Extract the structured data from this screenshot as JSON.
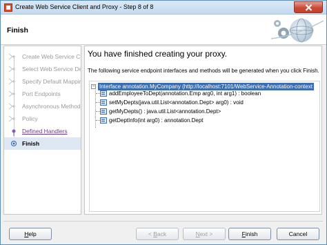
{
  "window": {
    "title": "Create Web Service Client and Proxy - Step 8 of 8"
  },
  "header": {
    "title": "Finish"
  },
  "steps": [
    {
      "label": "Create Web Service Client",
      "state": "done"
    },
    {
      "label": "Select Web Service Description",
      "state": "done"
    },
    {
      "label": "Specify Default Mapping",
      "state": "done"
    },
    {
      "label": "Port Endpoints",
      "state": "done"
    },
    {
      "label": "Asynchronous Methods",
      "state": "done"
    },
    {
      "label": "Policy",
      "state": "done"
    },
    {
      "label": "Defined Handlers",
      "state": "link"
    },
    {
      "label": "Finish",
      "state": "current"
    }
  ],
  "content": {
    "title": "You have finished creating your proxy.",
    "description": "The following service endpoint interfaces and methods will be generated when you click Finish.",
    "tree": {
      "root": "Interface annotation.MyCompany (http://localhost:7101/WebService-Annotation-context",
      "expander": "−",
      "methods": [
        "addEmployeeToDept(annotation.Emp arg0, int arg1) : boolean",
        "setMyDepts(java.util.List<annotation.Dept> arg0) : void",
        "getMyDepts() : java.util.List<annotation.Dept>",
        "getDeptInfo(int arg0) : annotation.Dept"
      ]
    }
  },
  "buttons": {
    "help": {
      "label": "Help",
      "mnemonic": "H",
      "rest": "elp"
    },
    "back": {
      "label": "< Back",
      "mnemonic": "B",
      "pre": "< ",
      "rest": "ack"
    },
    "next": {
      "label": "Next >",
      "mnemonic": "N",
      "rest": "ext >"
    },
    "finish": {
      "label": "Finish",
      "mnemonic": "F",
      "rest": "inish"
    },
    "cancel": {
      "label": "Cancel"
    }
  },
  "colors": {
    "selection": "#3b6db0",
    "current_step_bg": "#dde8f4",
    "link_step": "#6a3d8a",
    "title_bar": "#c4daf0",
    "close_button": "#c94a36"
  },
  "icons": {
    "title": "oracle-jdev-icon",
    "close": "close-icon",
    "header_logo": "globe-gear-icon",
    "method": "method-icon",
    "interface": "interface-icon"
  }
}
